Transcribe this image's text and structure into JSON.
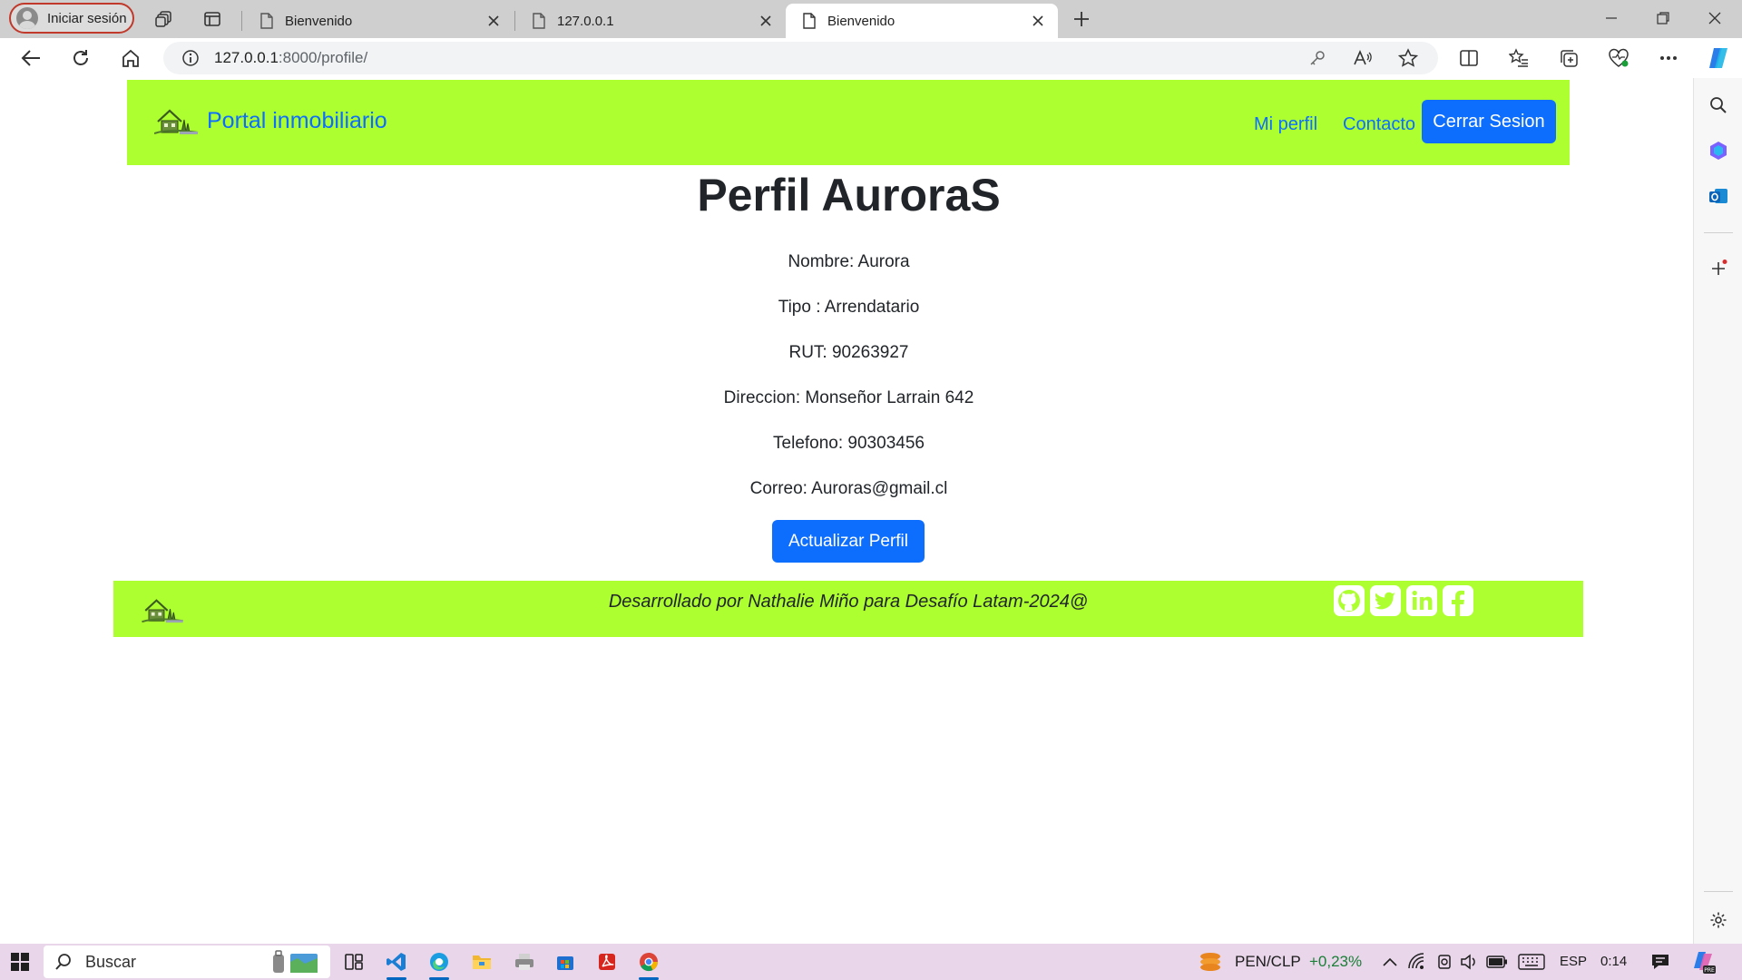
{
  "browser": {
    "profile_label": "Iniciar sesión",
    "tabs": [
      {
        "label": "Bienvenido",
        "active": false
      },
      {
        "label": "127.0.0.1",
        "active": false
      },
      {
        "label": "Bienvenido",
        "active": true
      }
    ],
    "url_host": "127.0.0.1",
    "url_path": ":8000/profile/"
  },
  "page": {
    "brand": "Portal inmobiliario",
    "nav_links": [
      "Mi perfil",
      "Contacto"
    ],
    "logout_label": "Cerrar Sesion",
    "title": "Perfil AuroraS",
    "fields": [
      "Nombre: Aurora",
      "Tipo : Arrendatario",
      "RUT: 90263927",
      "Direccion: Monseñor Larrain 642",
      "Telefono: 90303456",
      "Correo: Auroras@gmail.cl"
    ],
    "update_label": "Actualizar Perfil",
    "footer_text": "Desarrollado por Nathalie Miño para Desafío Latam-2024@",
    "social": [
      "github-icon",
      "twitter-icon",
      "linkedin-icon",
      "facebook-icon"
    ]
  },
  "taskbar": {
    "search_placeholder": "Buscar",
    "ticker": "PEN/CLP",
    "ticker_change": "+0,23%",
    "language": "ESP",
    "time": "0:14"
  },
  "colors": {
    "navbar_bg": "#adff2f",
    "primary": "#0d6efd",
    "ticker_up": "#1a7f37"
  }
}
